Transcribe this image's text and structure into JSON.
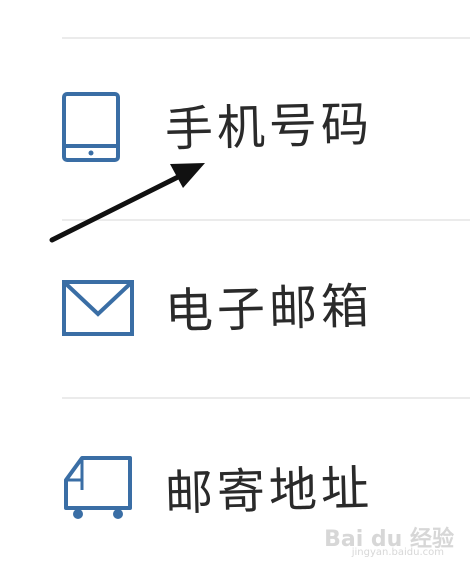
{
  "menu": {
    "items": [
      {
        "label": "手机号码",
        "icon": "tablet-icon"
      },
      {
        "label": "电子邮箱",
        "icon": "envelope-icon"
      },
      {
        "label": "邮寄地址",
        "icon": "delivery-truck-icon"
      }
    ]
  },
  "annotation": {
    "type": "arrow",
    "color": "#111111",
    "points_to": "手机号码"
  },
  "watermark": {
    "brand": "Bai du 经验",
    "url": "jingyan.baidu.com"
  },
  "colors": {
    "icon": "#3a6ea5",
    "text": "#2a2a2a",
    "divider": "#ebebeb"
  }
}
